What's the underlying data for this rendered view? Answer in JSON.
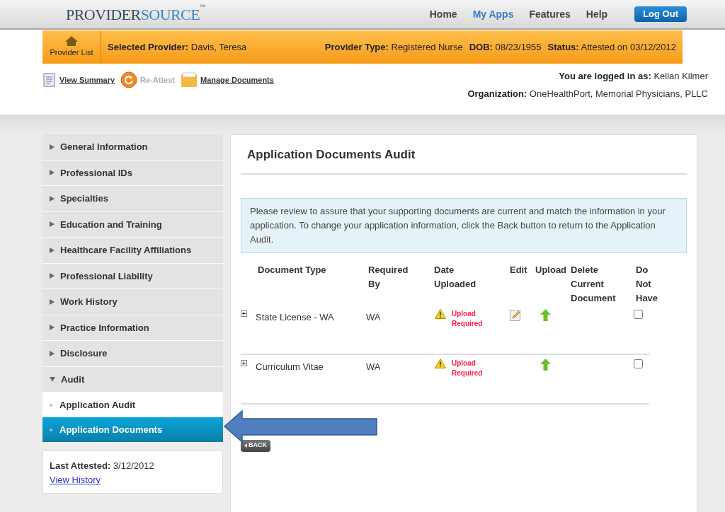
{
  "nav": {
    "logo": {
      "first": "PROVIDER",
      "second": "SOURCE",
      "mark": "™"
    },
    "links": [
      {
        "label": "Home",
        "selected": false
      },
      {
        "label": "My Apps",
        "selected": true
      },
      {
        "label": "Features",
        "selected": false
      },
      {
        "label": "Help",
        "selected": false
      }
    ],
    "logout": "Log Out"
  },
  "provider_bar": {
    "home_button": "Provider List",
    "fields": [
      {
        "label": "Selected Provider:",
        "value": "Davis, Teresa"
      },
      {
        "label": "Provider Type:",
        "value": "Registered Nurse"
      },
      {
        "label": "DOB:",
        "value": "08/23/1955"
      },
      {
        "label": "Status:",
        "value": "Attested on 03/12/2012"
      }
    ]
  },
  "actions": [
    {
      "kind": "summary",
      "label": "View Summary",
      "disabled": false
    },
    {
      "kind": "reattest",
      "label": "Re-Attest",
      "disabled": true
    },
    {
      "kind": "documents",
      "label": "Manage Documents",
      "disabled": false
    }
  ],
  "login": [
    {
      "label": "You are logged in as:",
      "value": "Kellan Kilmer"
    },
    {
      "label": "Organization:",
      "value": "OneHealthPort, Memorial Physicians, PLLC"
    }
  ],
  "sidebar": {
    "sections": [
      {
        "label": "General Information",
        "expanded": false
      },
      {
        "label": "Professional IDs",
        "expanded": false
      },
      {
        "label": "Specialties",
        "expanded": false
      },
      {
        "label": "Education and Training",
        "expanded": false
      },
      {
        "label": "Healthcare Facility Affiliations",
        "expanded": false
      },
      {
        "label": "Professional Liability",
        "expanded": false
      },
      {
        "label": "Work History",
        "expanded": false
      },
      {
        "label": "Practice Information",
        "expanded": false
      },
      {
        "label": "Disclosure",
        "expanded": false
      },
      {
        "label": "Audit",
        "expanded": true,
        "children": [
          {
            "label": "Application Audit",
            "selected": false
          },
          {
            "label": "Application Documents",
            "selected": true
          }
        ]
      }
    ],
    "last_attested": {
      "label": "Last Attested:",
      "value": "3/12/2012",
      "link": "View History"
    }
  },
  "main": {
    "title": "Application Documents Audit",
    "notice": "Please review to assure that your supporting documents are current and match the information in your application. To change your application information, click the Back button to return to the Application Audit.",
    "columns": [
      "Document Type",
      "Required By",
      "Date Uploaded",
      "Edit",
      "Upload",
      "Delete Current Document",
      "Do Not Have"
    ],
    "rows": [
      {
        "document_type": "State License - WA",
        "required_by": "WA",
        "status": "Upload Required",
        "editable": true,
        "uploadable": true,
        "do_not_have": false
      },
      {
        "document_type": "Curriculum Vitae",
        "required_by": "WA",
        "status": "Upload Required",
        "editable": false,
        "uploadable": true,
        "do_not_have": false
      }
    ],
    "back_button": "BACK"
  }
}
